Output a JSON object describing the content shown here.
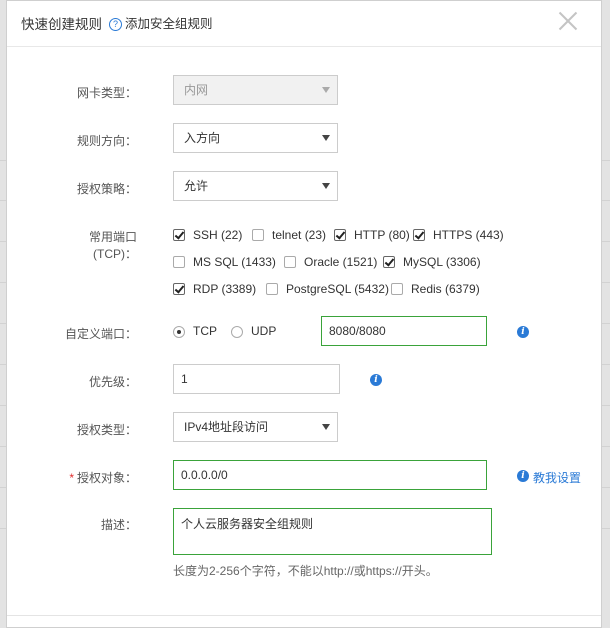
{
  "dialog": {
    "title": "快速创建规则",
    "help_link": "添加安全组规则",
    "help_icon_glyph": "?"
  },
  "nic_type": {
    "label": "网卡类型：",
    "value": "内网"
  },
  "direction": {
    "label": "规则方向：",
    "value": "入方向"
  },
  "policy": {
    "label": "授权策略：",
    "value": "允许"
  },
  "common_ports": {
    "label": "常用端口(TCP)：",
    "options": [
      {
        "label": "SSH (22)",
        "checked": true
      },
      {
        "label": "telnet (23)",
        "checked": false
      },
      {
        "label": "HTTP (80)",
        "checked": true
      },
      {
        "label": "HTTPS (443)",
        "checked": true
      },
      {
        "label": "MS SQL (1433)",
        "checked": false
      },
      {
        "label": "Oracle (1521)",
        "checked": false
      },
      {
        "label": "MySQL (3306)",
        "checked": true
      },
      {
        "label": "RDP (3389)",
        "checked": true
      },
      {
        "label": "PostgreSQL (5432)",
        "checked": false
      },
      {
        "label": "Redis (6379)",
        "checked": false
      }
    ]
  },
  "custom_port": {
    "label": "自定义端口：",
    "tcp_label": "TCP",
    "udp_label": "UDP",
    "selected": "TCP",
    "value": "8080/8080"
  },
  "priority": {
    "label": "优先级：",
    "value": "1"
  },
  "auth_type": {
    "label": "授权类型：",
    "value": "IPv4地址段访问"
  },
  "auth_object": {
    "required_mark": "*",
    "label": "授权对象：",
    "value": "0.0.0.0/0",
    "tutorial_link": "教我设置"
  },
  "description": {
    "label": "描述：",
    "value": "个人云服务器安全组规则",
    "hint": "长度为2-256个字符，不能以http://或https://开头。"
  },
  "colors": {
    "accent": "#2a7ad6",
    "valid_border": "#3aa33a",
    "required": "#e02c2c"
  }
}
